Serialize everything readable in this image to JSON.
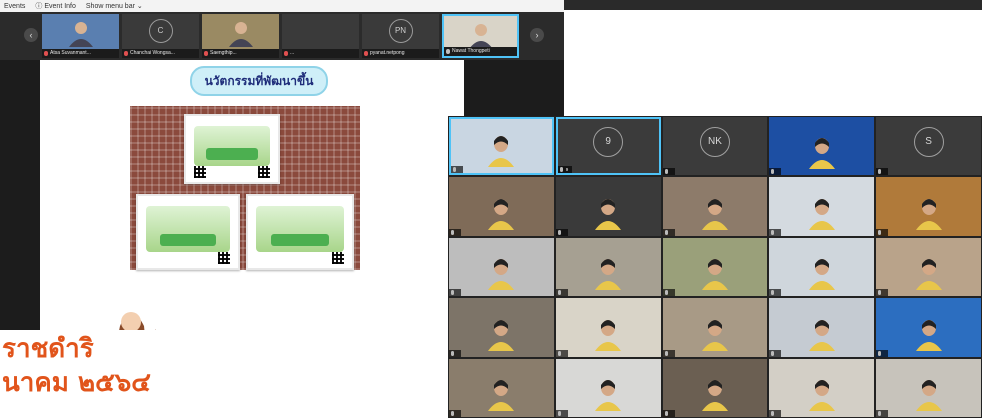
{
  "menubar": {
    "events": "Events",
    "event_info": "Event Info",
    "show_menu_bar": "Show menu bar"
  },
  "thumbnails": [
    {
      "name": "Atsa Suvanmant...",
      "initials": "",
      "photo": true,
      "mute": true,
      "active": false,
      "color": "#5a7fb0"
    },
    {
      "name": "Chanchai Wongsa...",
      "initials": "C",
      "photo": false,
      "mute": true,
      "active": false,
      "color": "#3a3a3a"
    },
    {
      "name": "Saengthip...",
      "initials": "",
      "photo": true,
      "mute": true,
      "active": false,
      "color": "#9a8a63"
    },
    {
      "name": "...",
      "initials": "",
      "photo": false,
      "mute": true,
      "active": false,
      "color": "#3a3a3a"
    },
    {
      "name": "pyanat.netpong",
      "initials": "PN",
      "photo": false,
      "mute": true,
      "active": false,
      "color": "#3a3a3a"
    },
    {
      "name": "Nawat Thongpeti",
      "initials": "",
      "photo": true,
      "mute": false,
      "active": true,
      "color": "#d9d4c8"
    }
  ],
  "slide": {
    "title": "นวัตกรรมที่พัฒนาขึ้น"
  },
  "caption": {
    "line1": "ราชดำริ",
    "line2": "นาคม ๒๕๖๔"
  },
  "gallery": {
    "tiles": [
      {
        "name": "",
        "initials": "",
        "bg": "#c9d6e2",
        "active": true
      },
      {
        "name": "9",
        "initials": "9",
        "bg": "#3b3b3b",
        "active": true
      },
      {
        "name": "",
        "initials": "NK",
        "bg": "#3b3b3b",
        "active": false
      },
      {
        "name": "",
        "initials": "",
        "bg": "#1d4fa3",
        "active": false
      },
      {
        "name": "",
        "initials": "S",
        "bg": "#3b3b3b",
        "active": false
      },
      {
        "name": "",
        "initials": "",
        "bg": "#7f6b58",
        "active": false
      },
      {
        "name": "",
        "initials": "",
        "bg": "#3a3a3a",
        "active": false
      },
      {
        "name": "",
        "initials": "",
        "bg": "#8d7b6a",
        "active": false
      },
      {
        "name": "",
        "initials": "",
        "bg": "#d4dae0",
        "active": false
      },
      {
        "name": "",
        "initials": "",
        "bg": "#b07a3a",
        "active": false
      },
      {
        "name": "",
        "initials": "",
        "bg": "#bdbdbd",
        "active": false
      },
      {
        "name": "",
        "initials": "",
        "bg": "#a6a092",
        "active": false
      },
      {
        "name": "",
        "initials": "",
        "bg": "#9aa07a",
        "active": false
      },
      {
        "name": "",
        "initials": "",
        "bg": "#cfd6dc",
        "active": false
      },
      {
        "name": "",
        "initials": "",
        "bg": "#b9a38a",
        "active": false
      },
      {
        "name": "",
        "initials": "",
        "bg": "#7d7468",
        "active": false
      },
      {
        "name": "",
        "initials": "",
        "bg": "#d9d4c8",
        "active": false
      },
      {
        "name": "",
        "initials": "",
        "bg": "#a89a86",
        "active": false
      },
      {
        "name": "",
        "initials": "",
        "bg": "#c5cbd2",
        "active": false
      },
      {
        "name": "",
        "initials": "",
        "bg": "#2c6ec0",
        "active": false
      },
      {
        "name": "",
        "initials": "",
        "bg": "#8a7d6c",
        "active": false
      },
      {
        "name": "",
        "initials": "",
        "bg": "#d8d8d6",
        "active": false
      },
      {
        "name": "",
        "initials": "",
        "bg": "#6b5f52",
        "active": false
      },
      {
        "name": "",
        "initials": "",
        "bg": "#d3cfc6",
        "active": false
      },
      {
        "name": "",
        "initials": "",
        "bg": "#c7c3bb",
        "active": false
      }
    ]
  }
}
